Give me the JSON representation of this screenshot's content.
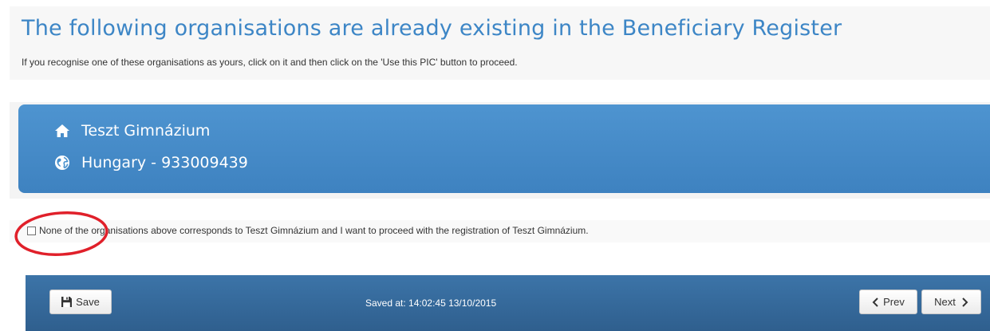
{
  "header": {
    "title": "The following organisations are already existing in the Beneficiary Register",
    "subtitle": "If you recognise one of these organisations as yours, click on it and then click on the 'Use this PIC' button to proceed."
  },
  "organisation": {
    "name": "Teszt Gimnázium",
    "country_pic": "Hungary - 933009439",
    "name_icon": "home-icon",
    "country_icon": "globe-icon"
  },
  "none_option": {
    "label": "None of the organisations above corresponds to Teszt Gimnázium and I want to proceed with the registration of Teszt Gimnázium.",
    "checked": false
  },
  "footer": {
    "save_label": "Save",
    "save_icon": "floppy-disk-icon",
    "saved_at": "Saved at: 14:02:45 13/10/2015",
    "prev_label": "Prev",
    "next_label": "Next",
    "prev_icon": "chevron-left-icon",
    "next_icon": "chevron-right-icon"
  },
  "colors": {
    "title": "#3d86c6",
    "card": "#4690cd",
    "footer": "#3567a0",
    "annotation": "#e0202a"
  }
}
